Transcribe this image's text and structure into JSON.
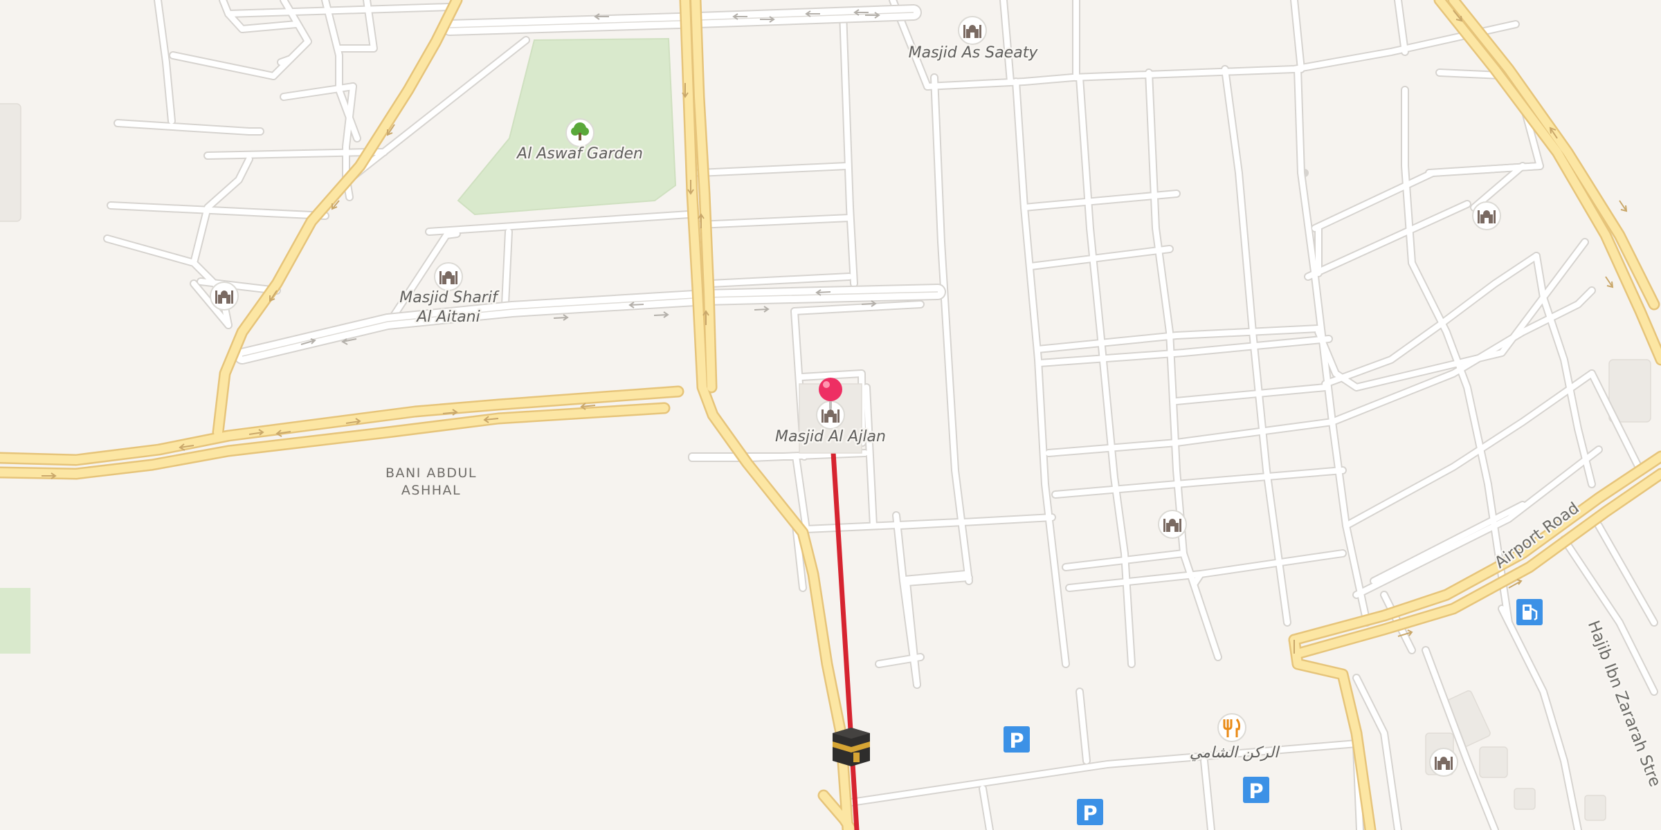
{
  "map": {
    "places": {
      "garden": "Al Aswaf Garden",
      "masjid_saeaty": "Masjid As Saeaty",
      "masjid_sharif_line1": "Masjid Sharif",
      "masjid_sharif_line2": "Al Aitani",
      "masjid_ajlan": "Masjid Al Ajlan",
      "restaurant": "الركن الشامي"
    },
    "district": {
      "line1": "BANI ABDUL",
      "line2": "ASHHAL"
    },
    "roads": {
      "airport_road": "Airport Road",
      "hajib_street": "Hajib Ibn Zararah Stre"
    },
    "icons": {
      "mosque": "mosque-icon",
      "tree": "tree-icon",
      "parking": "parking-icon",
      "fuel": "fuel-icon",
      "restaurant": "restaurant-icon",
      "kaaba": "kaaba-icon",
      "pin": "map-pin-icon"
    },
    "glyphs": {
      "parking": "P"
    },
    "colors": {
      "background": "#f6f3ef",
      "major_road": "#fce6a3",
      "major_road_casing": "#e6c47a",
      "park": "#d9e9cc",
      "route_line": "#d62430",
      "pin": "#ee2f63",
      "poi_blue": "#3c91e6"
    }
  }
}
